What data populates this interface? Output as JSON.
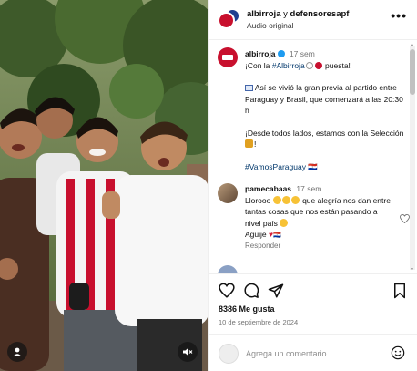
{
  "header": {
    "account1": "albirroja",
    "connector": "y",
    "account2": "defensoresapf",
    "subtitle": "Audio original"
  },
  "caption": {
    "username": "albirroja",
    "time": "17 sem",
    "line1_pre": "¡Con la ",
    "hashtag1": "#Albirroja",
    "line1_post": " puesta!",
    "para2": " Así se vivió la gran previa al partido entre Paraguay y Brasil, que comenzará a las 20:30 h",
    "para3": "¡Desde todos lados, estamos con la Selección",
    "para3_end": "!",
    "hashtag2": "#VamosParaguay",
    "hashtag2_suffix": " 🇵🇾"
  },
  "comment": {
    "username": "pamecabaas",
    "time": "17 sem",
    "text_a": "Llorooo ",
    "text_b": " que alegría nos dan entre tantas cosas que nos están pasando a nivel país ",
    "text_c": "Aguije ",
    "reply_label": "Responder"
  },
  "actions": {
    "likes": "8386 Me gusta",
    "date": "10 de septiembre de 2024"
  },
  "comment_box": {
    "placeholder": "Agrega un comentario..."
  },
  "icons": {
    "more": "more-options-icon",
    "mute": "speaker-muted-icon",
    "tagged": "user-tag-icon",
    "like": "heart-icon",
    "comment": "comment-bubble-icon",
    "share": "paper-plane-icon",
    "save": "bookmark-icon",
    "emoji": "emoji-smile-icon"
  },
  "colors": {
    "paraguay_red": "#c8102e",
    "paraguay_blue": "#1f3f8f",
    "hashtag": "#00376b",
    "muted_text": "#737373"
  }
}
